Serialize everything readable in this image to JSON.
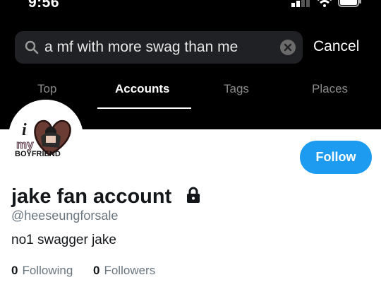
{
  "status_bar": {
    "time": "9:56"
  },
  "search": {
    "value": "a mf with more swag than me",
    "cancel_label": "Cancel"
  },
  "tabs": [
    {
      "label": "Top",
      "active": false
    },
    {
      "label": "Accounts",
      "active": true
    },
    {
      "label": "Tags",
      "active": false
    },
    {
      "label": "Places",
      "active": false
    }
  ],
  "profile": {
    "avatar_text": [
      "i",
      "my",
      "BOYFRIEND"
    ],
    "display_name": "jake fan account",
    "handle": "@heeseungforsale",
    "bio": "no1 swagger jake",
    "following_count": "0",
    "following_label": "Following",
    "followers_count": "0",
    "followers_label": "Followers",
    "follow_label": "Follow"
  },
  "colors": {
    "accent": "#1d9bf0",
    "top_bg": "#000000",
    "search_bg": "#202124"
  }
}
